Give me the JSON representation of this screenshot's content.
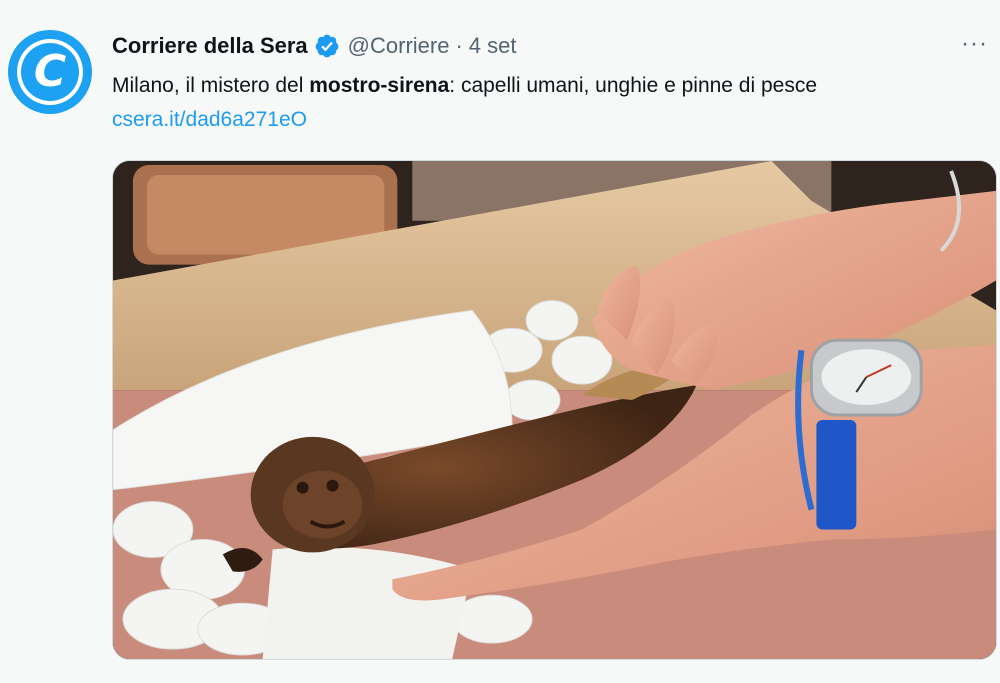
{
  "tweet": {
    "display_name": "Corriere della Sera",
    "handle": "@Corriere",
    "separator": "·",
    "date": "4 set",
    "more_label": "···",
    "avatar_letter": "C",
    "text_before": "Milano, il mistero del ",
    "text_bold": "mostro-sirena",
    "text_after": ": capelli umani, unghie e pinne di pesce",
    "link": "csera.it/dad6a271eO"
  },
  "colors": {
    "accent": "#1d9bf0",
    "avatar_blue": "#1da1f2",
    "secondary_text": "#536471",
    "background": "#f7f9f9"
  },
  "icons": {
    "verified": "verified-badge-icon",
    "more": "more-options-icon"
  }
}
